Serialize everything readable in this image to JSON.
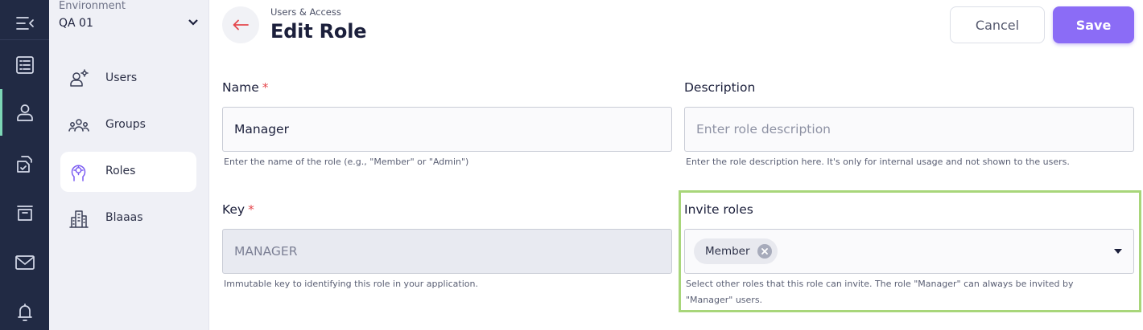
{
  "rail": {
    "items": [
      {
        "icon": "collapse-menu-icon"
      },
      {
        "icon": "list-icon"
      },
      {
        "icon": "user-icon",
        "active": true
      },
      {
        "icon": "documents-check-icon"
      },
      {
        "icon": "archive-icon"
      },
      {
        "icon": "mail-icon"
      },
      {
        "icon": "bell-icon"
      }
    ]
  },
  "sidebar": {
    "environment_label": "Environment",
    "environment_value": "QA 01",
    "items": [
      {
        "label": "Users",
        "icon": "users-settings-icon"
      },
      {
        "label": "Groups",
        "icon": "groups-icon"
      },
      {
        "label": "Roles",
        "icon": "roles-icon",
        "active": true
      },
      {
        "label": "Blaaas",
        "icon": "buildings-icon"
      }
    ]
  },
  "header": {
    "breadcrumb": "Users & Access",
    "title": "Edit Role",
    "cancel_label": "Cancel",
    "save_label": "Save"
  },
  "form": {
    "name": {
      "label": "Name",
      "required_mark": "*",
      "value": "Manager",
      "hint": "Enter the name of the role (e.g., \"Member\" or \"Admin\")"
    },
    "description": {
      "label": "Description",
      "placeholder": "Enter role description",
      "hint": "Enter the role description here. It's only for internal usage and not shown to the users."
    },
    "key": {
      "label": "Key",
      "required_mark": "*",
      "value": "MANAGER",
      "hint": "Immutable key to identifying this role in your application."
    },
    "invite_roles": {
      "label": "Invite roles",
      "selected": [
        "Member"
      ],
      "hint_line1": "Select other roles that this role can invite. The role \"Manager\" can always be invited by",
      "hint_line2": "\"Manager\" users."
    }
  },
  "colors": {
    "rail_bg": "#212a44",
    "sidebar_bg": "#eff0f6",
    "accent": "#8b6cf6",
    "required": "#e5484d",
    "highlight": "#a8d67a",
    "active_rail_marker": "#7cd6b6"
  }
}
